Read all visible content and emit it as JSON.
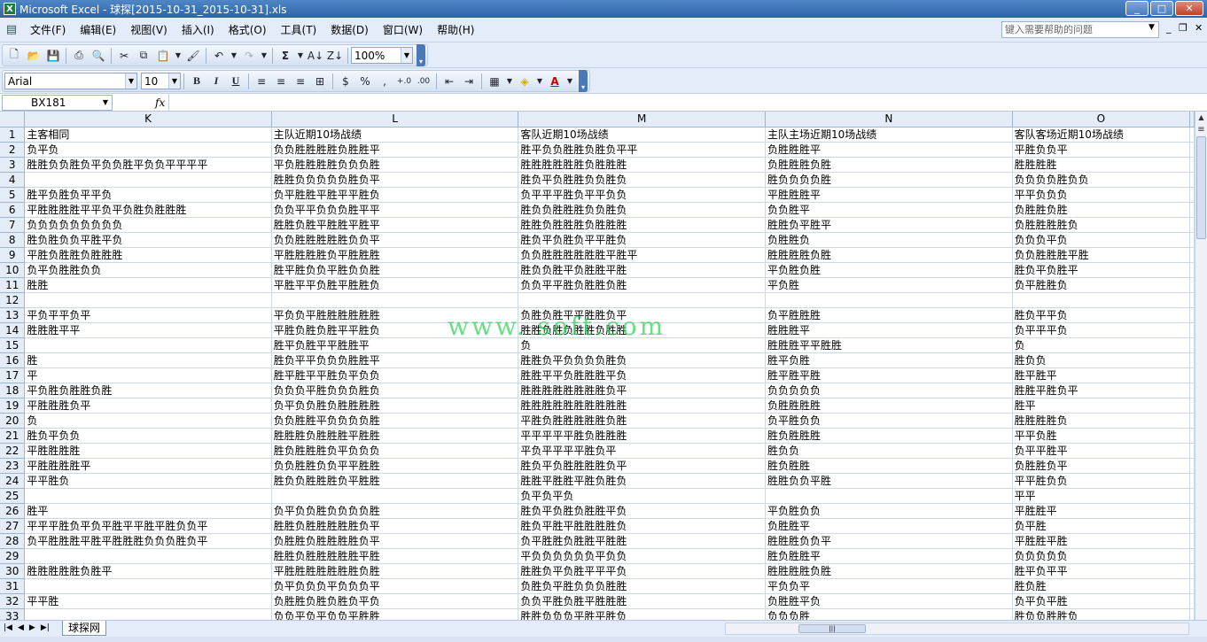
{
  "window": {
    "title": "Microsoft Excel - 球探[2015-10-31_2015-10-31].xls",
    "min": "_",
    "max": "□",
    "close": "✕"
  },
  "menu": {
    "items": [
      "文件(F)",
      "编辑(E)",
      "视图(V)",
      "插入(I)",
      "格式(O)",
      "工具(T)",
      "数据(D)",
      "窗口(W)",
      "帮助(H)"
    ],
    "help_placeholder": "键入需要帮助的问题"
  },
  "toolbar": {
    "zoom": "100%",
    "font": "Arial",
    "size": "10",
    "bold": "B",
    "italic": "I",
    "underline": "U",
    "percent": "%",
    "comma": ","
  },
  "formula": {
    "cell_ref": "BX181",
    "fx": "fx"
  },
  "colors": {
    "accent": "#2f65a8",
    "watermark": "#22cc55"
  },
  "watermark": "www.          soft.com",
  "grid": {
    "columns": [
      "K",
      "L",
      "M",
      "N",
      "O"
    ],
    "rows": [
      {
        "n": "1",
        "c": [
          "主客相同",
          "主队近期10场战绩",
          "客队近期10场战绩",
          "主队主场近期10场战绩",
          "客队客场近期10场战绩"
        ]
      },
      {
        "n": "2",
        "c": [
          "负平负",
          "负负胜胜胜胜负胜胜平",
          "胜平负负胜胜负胜负平平",
          "负胜胜胜平",
          "平胜负负平"
        ]
      },
      {
        "n": "3",
        "c": [
          "胜胜负负胜负平负负胜平负负平平平平",
          "平负胜胜胜胜负负负胜",
          "胜胜胜胜胜胜负胜胜胜",
          "负胜胜胜负胜",
          "胜胜胜胜"
        ]
      },
      {
        "n": "4",
        "c": [
          "",
          "胜胜负负负负负胜负平",
          "胜负平负胜胜负负胜负",
          "胜负负负负胜",
          "负负负负胜负负"
        ]
      },
      {
        "n": "5",
        "c": [
          "胜平负胜负平平负",
          "负平胜胜平胜平平胜负",
          "负平平平胜负平平负负",
          "平胜胜胜平",
          "平平负负负"
        ]
      },
      {
        "n": "6",
        "c": [
          "平胜胜胜胜平平负平负胜负胜胜胜",
          "负负平平负负负胜平平",
          "胜负负胜胜胜负负胜负",
          "负负胜平",
          "负胜胜负胜"
        ]
      },
      {
        "n": "7",
        "c": [
          "负负负负负负负负负",
          "胜胜负胜平胜胜平胜平",
          "胜胜负胜胜胜负胜胜胜",
          "胜胜负平胜平",
          "负胜胜胜胜负"
        ]
      },
      {
        "n": "8",
        "c": [
          "胜负胜负负平胜平负",
          "负负胜胜胜胜胜负负平",
          "胜负平负胜负平平胜负",
          "负胜胜负",
          "负负负平负"
        ]
      },
      {
        "n": "9",
        "c": [
          "平胜负胜胜负胜胜胜",
          "平胜胜胜胜负平胜胜胜",
          "负负胜胜胜胜胜胜平胜平",
          "胜胜胜胜负胜",
          "负负胜胜胜平胜"
        ]
      },
      {
        "n": "10",
        "c": [
          "负平负胜胜负负",
          "胜平胜负负平胜负负胜",
          "胜负负胜平负胜胜平胜",
          "平负胜负胜",
          "胜负平负胜平"
        ]
      },
      {
        "n": "11",
        "c": [
          "胜胜",
          "平胜平平负胜平胜胜负",
          "负负平平胜负胜胜负胜",
          "平负胜",
          "负平胜胜负"
        ]
      },
      {
        "n": "12",
        "c": [
          "",
          "",
          "",
          "",
          ""
        ]
      },
      {
        "n": "13",
        "c": [
          "平负平平负平",
          "平负负平胜胜胜胜胜胜",
          "负胜负胜平平胜胜负平",
          "负平胜胜胜",
          "胜负平平负"
        ]
      },
      {
        "n": "14",
        "c": [
          "胜胜胜平平",
          "平胜负胜负胜平平胜负",
          "胜胜负胜负胜胜负胜胜",
          "胜胜胜平",
          "负平平平负"
        ]
      },
      {
        "n": "15",
        "c": [
          "",
          "胜平负胜平平胜胜平",
          "负",
          "胜胜胜平平胜胜",
          "负"
        ]
      },
      {
        "n": "16",
        "c": [
          "胜",
          "胜负平平负负负胜胜平",
          "胜胜负平负负负负胜负",
          "胜平负胜",
          "胜负负"
        ]
      },
      {
        "n": "17",
        "c": [
          "平",
          "胜平胜平平胜负平负负",
          "胜胜平平负胜胜胜平负",
          "胜平胜平胜",
          "胜平胜平"
        ]
      },
      {
        "n": "18",
        "c": [
          "平负胜负胜胜负胜",
          "负负负平胜负负负胜负",
          "胜胜胜胜胜胜胜胜负平",
          "负负负负负",
          "胜胜平胜负平"
        ]
      },
      {
        "n": "19",
        "c": [
          "平胜胜胜负平",
          "负平负负胜负胜胜胜胜",
          "胜胜胜胜胜胜胜胜胜胜",
          "负胜胜胜胜",
          "胜平"
        ]
      },
      {
        "n": "20",
        "c": [
          "负",
          "负负胜胜平负负负负胜",
          "平胜负胜胜胜胜胜负胜",
          "负平胜负负",
          "胜胜胜胜负"
        ]
      },
      {
        "n": "21",
        "c": [
          "胜负平负负",
          "胜胜胜负胜胜胜平胜胜",
          "平平平平平胜负胜胜胜",
          "胜负胜胜胜",
          "平平负胜"
        ]
      },
      {
        "n": "22",
        "c": [
          "平胜胜胜胜",
          "胜负胜胜胜负平负负负",
          "平负平平平平胜负平",
          "胜负负",
          "负平平胜平"
        ]
      },
      {
        "n": "23",
        "c": [
          "平胜胜胜胜平",
          "负负胜胜负负平平胜胜",
          "胜负平负胜胜胜胜负平",
          "胜负胜胜",
          "负胜胜负平"
        ]
      },
      {
        "n": "24",
        "c": [
          "平平胜负",
          "胜负负胜胜胜负平胜胜",
          "胜胜平胜胜平胜负胜负",
          "胜胜负负平胜",
          "平平胜负负"
        ]
      },
      {
        "n": "25",
        "c": [
          "",
          "",
          "负平负平负",
          "",
          "平平"
        ]
      },
      {
        "n": "26",
        "c": [
          "胜平",
          "负平负负胜负负负负胜",
          "胜负平负胜负胜胜平负",
          "平负胜负负",
          "平胜胜平"
        ]
      },
      {
        "n": "27",
        "c": [
          "平平平胜负平负平胜平平胜平胜负负平",
          "胜胜负胜胜胜胜胜负平",
          "胜负平胜平胜胜胜胜负",
          "负胜胜平",
          "负平胜"
        ]
      },
      {
        "n": "28",
        "c": [
          "负平胜胜胜平胜平胜胜胜负负负胜负平",
          "负胜胜负胜胜胜胜负平",
          "负平胜胜负胜胜平胜胜",
          "胜胜胜负负平",
          "平胜胜平胜"
        ]
      },
      {
        "n": "29",
        "c": [
          "",
          "胜胜负胜胜胜胜胜平胜",
          "平负负负负负负平负负",
          "胜负胜胜平",
          "负负负负负"
        ]
      },
      {
        "n": "30",
        "c": [
          "胜胜胜胜胜负胜平",
          "平胜胜胜胜胜胜胜负胜",
          "胜胜负平负胜平平平负",
          "胜胜胜胜负胜",
          "胜平负平平"
        ]
      },
      {
        "n": "31",
        "c": [
          "",
          "负平负负负平负负负平",
          "负胜负平胜负负负胜胜",
          "平负负平",
          "胜负胜"
        ]
      },
      {
        "n": "32",
        "c": [
          "平平胜",
          "负胜胜负胜负胜负平负",
          "负负平胜负胜平胜胜胜",
          "负胜胜平负",
          "负平负平胜"
        ]
      },
      {
        "n": "33",
        "c": [
          "",
          "负负平负平负负平胜胜",
          "胜胜负负负平胜平胜负",
          "负负负胜",
          "胜负负胜胜负"
        ]
      }
    ]
  },
  "sheet_tab": "球探网"
}
